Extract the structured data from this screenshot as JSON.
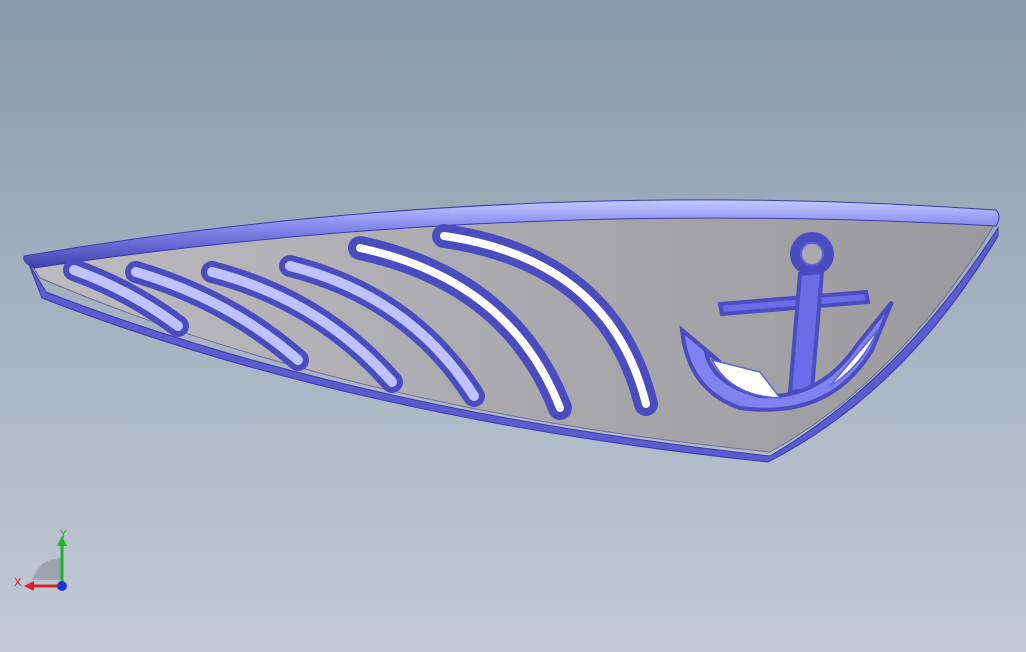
{
  "viewport": {
    "background_top": "#8a9aac",
    "background_bottom": "#c3cad6"
  },
  "model": {
    "description_icon": "boat-hull-panel-with-anchor-icon",
    "face_color": "#a8a8ac",
    "edge_color": "#5558d8",
    "highlight_color": "#9fa3ff",
    "slot_count": 6
  },
  "triad": {
    "x_label": "X",
    "y_label": "Y",
    "x_color": "#d8232a",
    "y_color": "#1db32b",
    "z_color": "#2233cc"
  }
}
